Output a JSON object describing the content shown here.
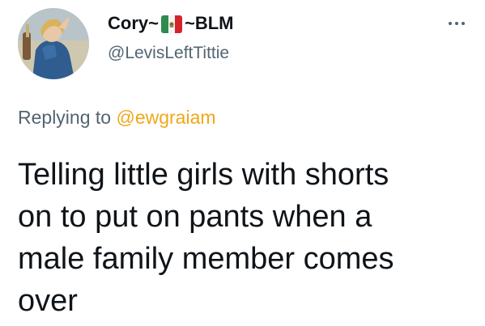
{
  "user": {
    "name_prefix": "Cory~",
    "name_suffix": "~BLM",
    "flag_icon": "mexico-flag-icon",
    "handle": "@LevisLeftTittie",
    "avatar_icon": "profile-avatar"
  },
  "more_icon": "more-options-icon",
  "reply": {
    "prefix": "Replying to ",
    "mention": "@ewgraiam"
  },
  "tweet": {
    "lines": [
      "Telling little girls with shorts",
      "on to put on pants when a",
      "male family member comes",
      "over"
    ]
  },
  "colors": {
    "text": "#0f1419",
    "secondary": "#536471",
    "mention": "#f0a81a"
  }
}
